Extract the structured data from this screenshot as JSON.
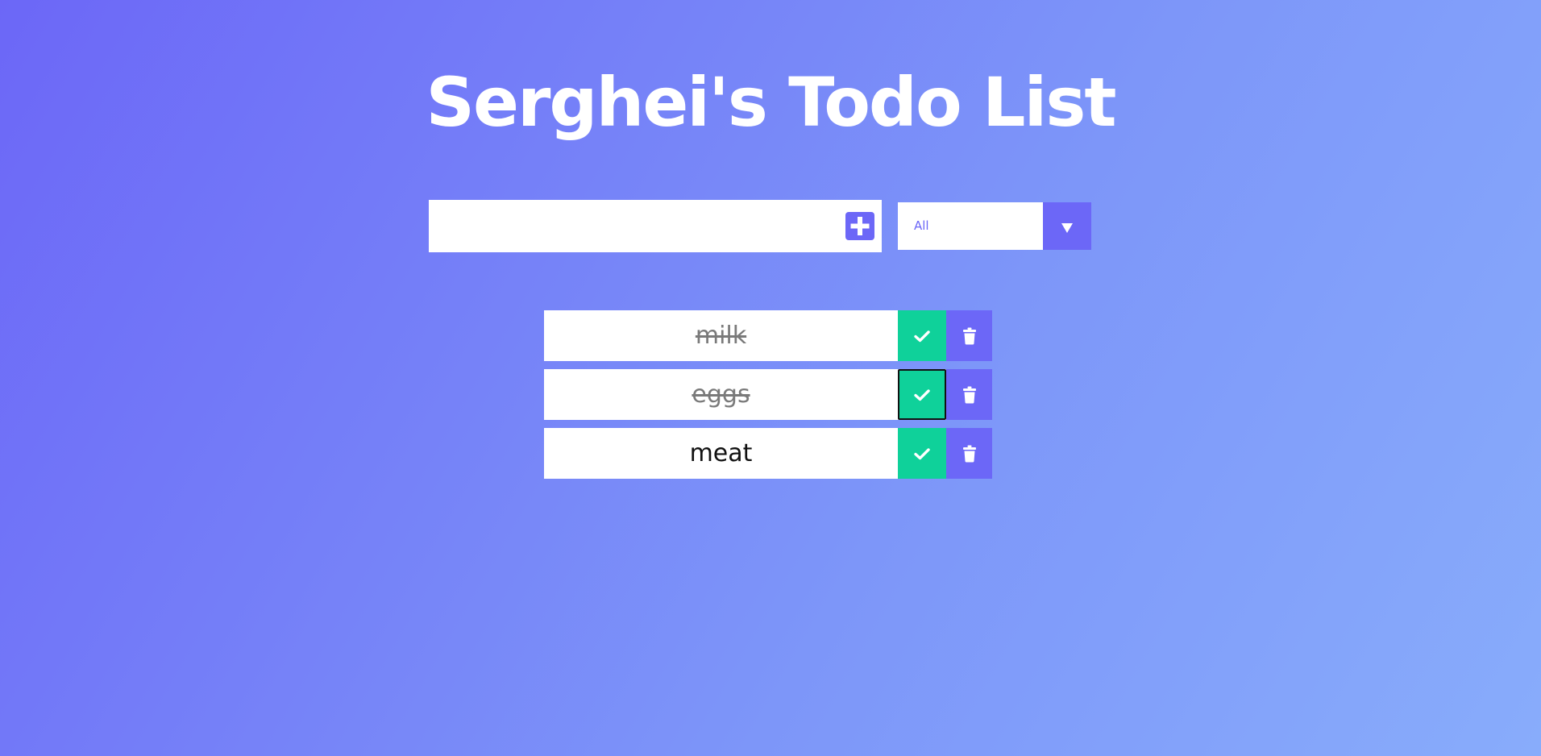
{
  "header": {
    "title": "Serghei's Todo List"
  },
  "form": {
    "input_value": "",
    "input_placeholder": "",
    "add_icon": "plus-square-icon"
  },
  "filter": {
    "selected": "All",
    "arrow_icon": "caret-down-icon"
  },
  "todos": [
    {
      "text": "milk",
      "completed": true,
      "check_focused": false
    },
    {
      "text": "eggs",
      "completed": true,
      "check_focused": true
    },
    {
      "text": "meat",
      "completed": false,
      "check_focused": false
    }
  ],
  "colors": {
    "accent": "#6c67f7",
    "complete": "#0fd19a",
    "background_start": "#6c67f7",
    "background_end": "#88acfb"
  }
}
